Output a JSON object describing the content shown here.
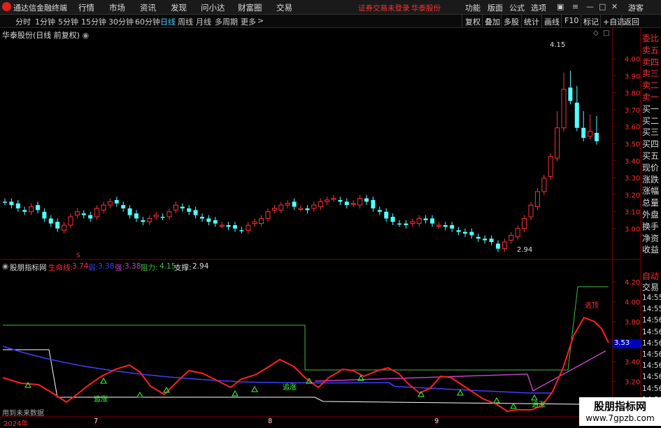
{
  "window": {
    "app_title": "通达信金融终端",
    "menu": [
      "行情",
      "市场",
      "资讯",
      "发现",
      "问小达",
      "财富圈",
      "交易"
    ],
    "warning": "证券交易未登录",
    "stock_name_top": "华泰股份",
    "right_menu": [
      "功能",
      "版面",
      "公式",
      "选项"
    ],
    "guest": "游客"
  },
  "periods": {
    "items": [
      "分时",
      "1分钟",
      "5分钟",
      "15分钟",
      "30分钟",
      "60分钟",
      "日线",
      "周线",
      "月线",
      "多周期",
      "更多"
    ],
    "active": "日线"
  },
  "toolbar": {
    "buttons": [
      "复权",
      "叠加",
      "多股",
      "统计",
      "画线",
      "F10",
      "标记",
      "+自选",
      "返回"
    ]
  },
  "main_chart": {
    "label": "华泰股份(日线 前复权)",
    "high_label": "4.15",
    "low_label": "2.94",
    "price_ticks": [
      "4.00",
      "3.90",
      "3.80",
      "3.70",
      "3.60",
      "3.50",
      "3.40",
      "3.30",
      "3.20",
      "3.10",
      "3.00"
    ],
    "marker": "S"
  },
  "indicator": {
    "name": "股朋指标网",
    "lifeline_label": "生命线:",
    "lifeline_value": "3.74",
    "weak_label": "弱:",
    "weak_value": "3.38",
    "strong_label": "强:",
    "strong_value": "3.38",
    "resist_label": "阻力:",
    "resist_value": "4.15",
    "support_label": "支撑:",
    "support_value": "2.94",
    "ticks": [
      "4.20",
      "4.00",
      "3.80",
      "3.60",
      "3.40",
      "3.20"
    ],
    "current_box": "3.53",
    "signals": [
      "追涨",
      "追涨",
      "追涨"
    ],
    "top_signal": "逃顶",
    "bottom_note": "用到未来数据"
  },
  "right_panel": {
    "top": [
      "委比",
      "卖五",
      "卖四",
      "卖三",
      "卖二",
      "卖一",
      "买一",
      "买二",
      "买三",
      "买四",
      "买五",
      "现价",
      "涨跌",
      "涨幅",
      "总量",
      "外盘",
      "换手",
      "净资",
      "收益"
    ],
    "bottom_title": "自动",
    "bottom_sub": "交易",
    "times": [
      "14:55",
      "14:55",
      "14:56",
      "14:56",
      "14:56",
      "14:56",
      "14:56",
      "14:56",
      "14:56",
      "14:56"
    ]
  },
  "x_axis": {
    "labels": [
      "2024年",
      "7",
      "8",
      "9"
    ]
  },
  "watermark": {
    "name": "股朋指标网",
    "url": "www.7gpzb.com"
  },
  "colors": {
    "up": "#ff3232",
    "down": "#54ffff",
    "lifeline": "#ff2020",
    "weak": "#4040ff",
    "strong": "#c040c0",
    "resist": "#40c040",
    "support": "#ffffff"
  }
}
